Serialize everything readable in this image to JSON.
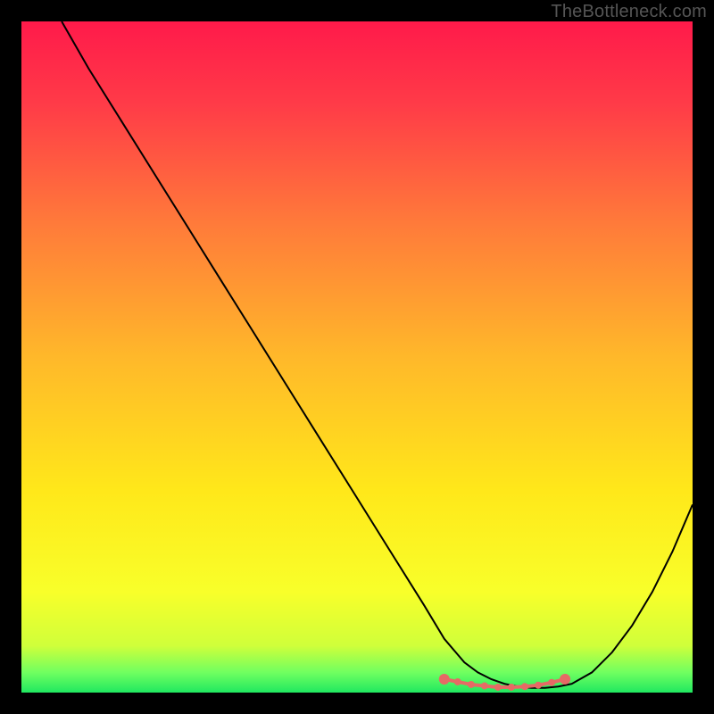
{
  "watermark": "TheBottleneck.com",
  "chart_data": {
    "type": "line",
    "title": "",
    "xlabel": "",
    "ylabel": "",
    "xlim": [
      0,
      100
    ],
    "ylim": [
      0,
      100
    ],
    "grid": false,
    "series": [
      {
        "name": "curve",
        "color": "#000000",
        "x": [
          6,
          10,
          15,
          20,
          25,
          30,
          35,
          40,
          45,
          50,
          55,
          60,
          63,
          66,
          68,
          70,
          72,
          74,
          76,
          78,
          80,
          82,
          85,
          88,
          91,
          94,
          97,
          100
        ],
        "y": [
          100,
          93,
          85,
          77,
          69,
          61,
          53,
          45,
          37,
          29,
          21,
          13,
          8,
          4.5,
          3,
          2,
          1.3,
          0.9,
          0.7,
          0.7,
          0.9,
          1.3,
          3,
          6,
          10,
          15,
          21,
          28
        ]
      },
      {
        "name": "highlight",
        "color": "#e66a65",
        "x": [
          63,
          65,
          67,
          69,
          71,
          73,
          75,
          77,
          79,
          81
        ],
        "y": [
          2.0,
          1.6,
          1.2,
          1.0,
          0.8,
          0.8,
          0.9,
          1.1,
          1.5,
          2.0
        ]
      }
    ],
    "gradient_stops": [
      {
        "offset": 0.0,
        "color": "#ff1a4a"
      },
      {
        "offset": 0.12,
        "color": "#ff3a48"
      },
      {
        "offset": 0.3,
        "color": "#ff7a3a"
      },
      {
        "offset": 0.5,
        "color": "#ffb82a"
      },
      {
        "offset": 0.7,
        "color": "#ffe81a"
      },
      {
        "offset": 0.85,
        "color": "#f8ff2a"
      },
      {
        "offset": 0.93,
        "color": "#d0ff3a"
      },
      {
        "offset": 0.97,
        "color": "#70ff60"
      },
      {
        "offset": 1.0,
        "color": "#20e860"
      }
    ]
  }
}
